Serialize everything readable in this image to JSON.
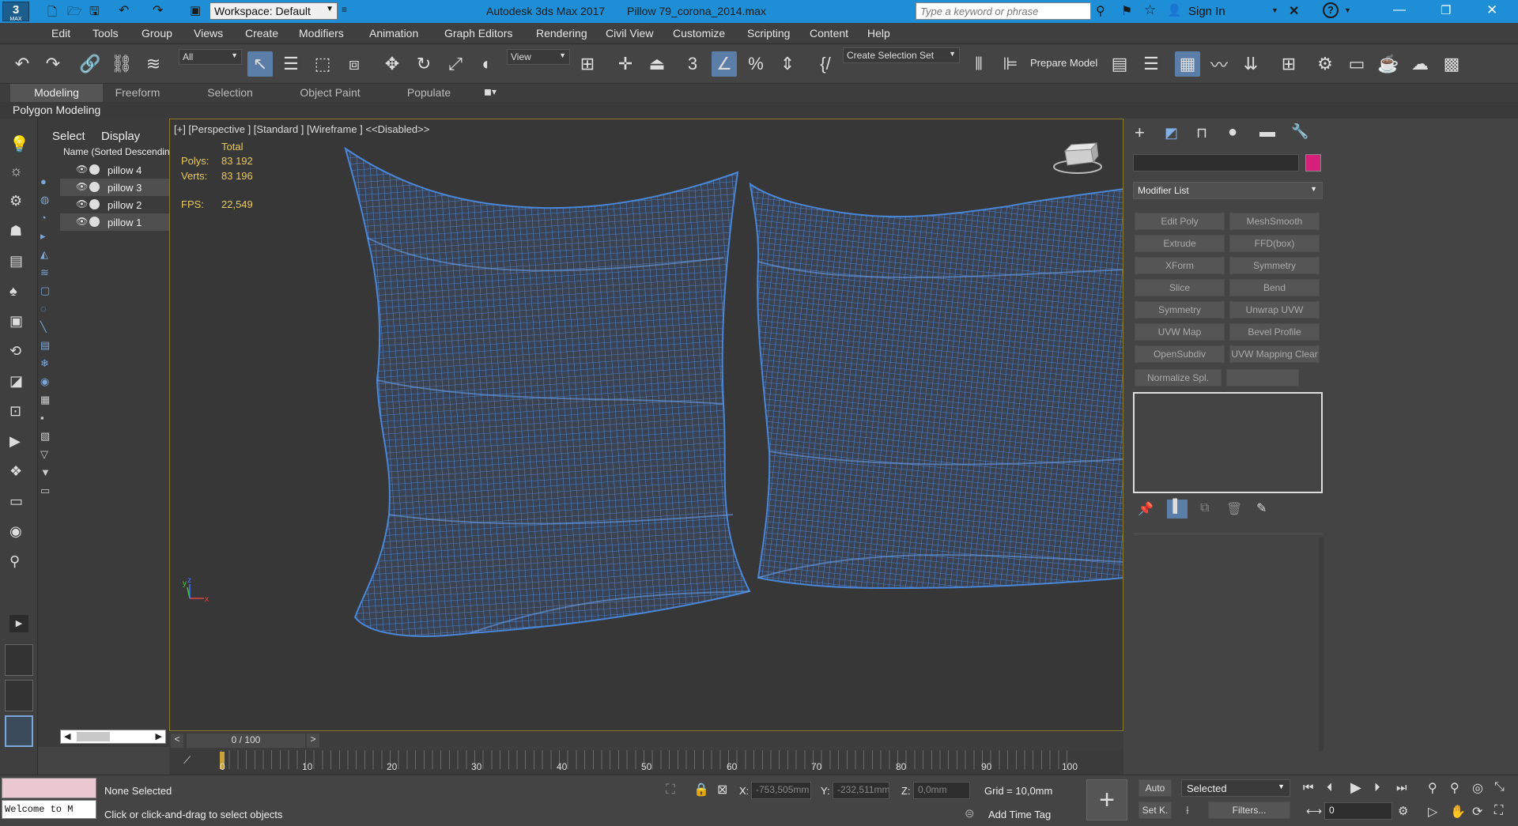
{
  "titlebar": {
    "workspace": "Workspace: Default",
    "app_title": "Autodesk 3ds Max 2017",
    "file_name": "Pillow 79_corona_2014.max",
    "search_placeholder": "Type a keyword or phrase",
    "sign_in": "Sign In",
    "logo_text": "MAX"
  },
  "menu": [
    "Edit",
    "Tools",
    "Group",
    "Views",
    "Create",
    "Modifiers",
    "Animation",
    "Graph Editors",
    "Rendering",
    "Civil View",
    "Customize",
    "Scripting",
    "Content",
    "Help"
  ],
  "toolbar": {
    "filter_select": "All",
    "ref_coord_select": "View",
    "selection_set": "Create Selection Set",
    "prepare_model": "Prepare Model"
  },
  "ribbon": {
    "tabs": [
      "Modeling",
      "Freeform",
      "Selection",
      "Object Paint",
      "Populate"
    ],
    "active_tab": "Modeling",
    "sub_label": "Polygon Modeling"
  },
  "scene_explorer": {
    "tabs": [
      "Select",
      "Display"
    ],
    "column_header": "Name (Sorted Descending)",
    "items": [
      "pillow 4",
      "pillow 3",
      "pillow 2",
      "pillow 1"
    ]
  },
  "viewport": {
    "label": "[+] [Perspective ] [Standard ] [Wireframe ] <<Disabled>>",
    "stats_header": "Total",
    "polys_label": "Polys:",
    "polys_value": "83 192",
    "verts_label": "Verts:",
    "verts_value": "83 196",
    "fps_label": "FPS:",
    "fps_value": "22,549",
    "wire_color": "#4a86d8",
    "axis_labels": [
      "x",
      "y",
      "z"
    ]
  },
  "command_panel": {
    "modifier_list": "Modifier List",
    "object_color": "#d6207a",
    "buttons": [
      "Edit Poly",
      "MeshSmooth",
      "Extrude",
      "FFD(box)",
      "XForm",
      "Symmetry",
      "Slice",
      "Bend",
      "Symmetry",
      "Unwrap UVW",
      "UVW Map",
      "Bevel Profile",
      "OpenSubdiv",
      "UVW Mapping Clear",
      "Normalize Spl."
    ]
  },
  "timeline": {
    "frame_display": "0 / 100",
    "prev": "<",
    "next": ">",
    "ticks": [
      "0",
      "10",
      "20",
      "30",
      "40",
      "50",
      "60",
      "70",
      "80",
      "90",
      "100"
    ]
  },
  "status": {
    "maxscript": "Welcome to M",
    "selection": "None Selected",
    "prompt": "Click or click-and-drag to select objects",
    "x_label": "X:",
    "x_value": "-753,505mm",
    "y_label": "Y:",
    "y_value": "-232,511mm",
    "z_label": "Z:",
    "z_value": "0,0mm",
    "grid": "Grid = 10,0mm",
    "add_time_tag": "Add Time Tag",
    "auto": "Auto",
    "set_key": "Set K.",
    "selected_select": "Selected",
    "filters": "Filters...",
    "frame_spinner": "0"
  }
}
